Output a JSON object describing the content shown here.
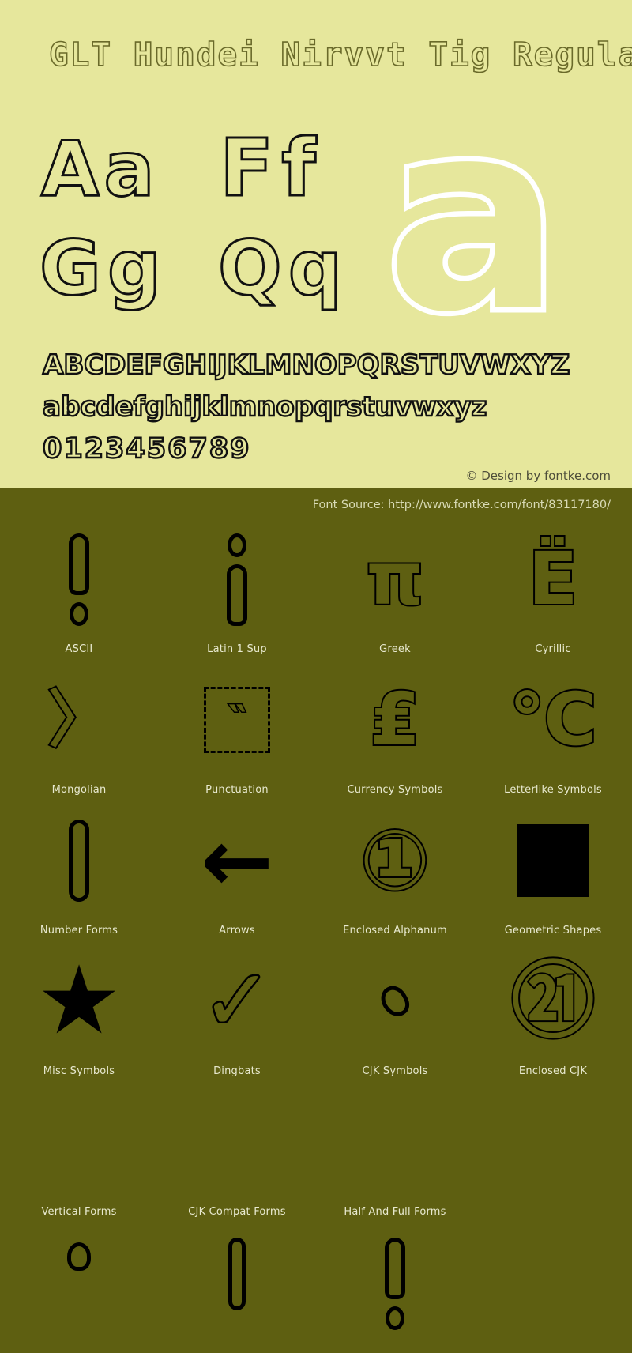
{
  "specimen": {
    "title": "GLT Hundei Nirvvt Tig Regular",
    "samples": {
      "aa": "Aa",
      "ff": "Ff",
      "gg": "Gg",
      "qq": "Qq",
      "hero": "a"
    },
    "charset": {
      "uppercase": "ABCDEFGHIJKLMNOPQRSTUVWXYZ",
      "lowercase": "abcdefghijklmnopqrstuvwxyz",
      "digits": "0123456789"
    },
    "copyright": "© Design by fontke.com"
  },
  "blocks_panel": {
    "font_source": "Font Source: http://www.fontke.com/font/83117180/",
    "rows": [
      {
        "cells": [
          {
            "label": "ASCII",
            "glyph": "!",
            "style": "excl"
          },
          {
            "label": "Latin 1 Sup",
            "glyph": "¡",
            "style": "excl-inverted"
          },
          {
            "label": "Greek",
            "glyph": "π",
            "style": "outline-lg"
          },
          {
            "label": "Cyrillic",
            "glyph": "Ё",
            "style": "outline-lg"
          }
        ]
      },
      {
        "cells": [
          {
            "label": "Mongolian",
            "glyph": "〉",
            "style": "outline-md"
          },
          {
            "label": "Punctuation",
            "glyph": "‶",
            "style": "dashed-box"
          },
          {
            "label": "Currency Symbols",
            "glyph": "₤",
            "style": "outline-lg"
          },
          {
            "label": "Letterlike Symbols",
            "glyph": "℃",
            "style": "outline-lg"
          }
        ]
      },
      {
        "cells": [
          {
            "label": "Number Forms",
            "glyph": "Ⅰ",
            "style": "tall-bar"
          },
          {
            "label": "Arrows",
            "glyph": "←",
            "style": "arrow-left"
          },
          {
            "label": "Enclosed Alphanum",
            "glyph": "①",
            "style": "outline-xl"
          },
          {
            "label": "Geometric Shapes",
            "glyph": "■",
            "style": "solid-square"
          }
        ]
      },
      {
        "cells": [
          {
            "label": "Misc Symbols",
            "glyph": "★",
            "style": "solid-star"
          },
          {
            "label": "Dingbats",
            "glyph": "✓",
            "style": "checkmark"
          },
          {
            "label": "CJK Symbols",
            "glyph": "、",
            "style": "bean"
          },
          {
            "label": "Enclosed CJK",
            "glyph": "㉑",
            "style": "outline-xl"
          }
        ]
      },
      {
        "cells": [
          {
            "label": "Vertical Forms",
            "glyph": "︐",
            "style": "teardrop"
          },
          {
            "label": "CJK Compat Forms",
            "glyph": "｜",
            "style": "tall-bar-sm"
          },
          {
            "label": "Half And Full Forms",
            "glyph": "！",
            "style": "excl"
          },
          {
            "label": "",
            "glyph": "",
            "style": "none"
          }
        ]
      }
    ]
  },
  "colors": {
    "specimen_background": "#e6e79c",
    "blocks_background": "#5e5f11",
    "glyph_outline": "#111111",
    "hero_outline": "#ffffff",
    "label_text": "#e8e9cf",
    "copyright_text": "#4d4d3a"
  }
}
